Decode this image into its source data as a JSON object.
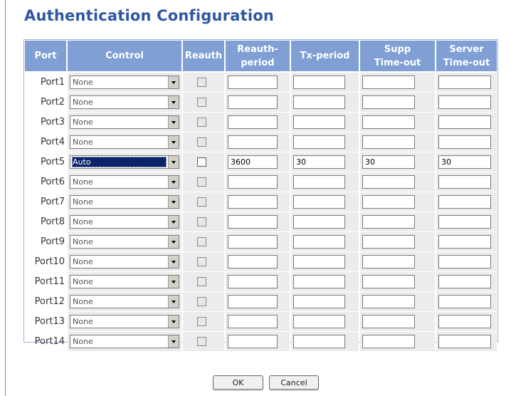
{
  "title": "Authentication Configuration",
  "headers": {
    "port": "Port",
    "control": "Control",
    "reauth": "Reauth",
    "reauth_period": "Reauth-\nperiod",
    "tx_period": "Tx-period",
    "supp_timeout": "Supp\nTime-out",
    "server_timeout": "Server\nTime-out"
  },
  "rows": [
    {
      "port": "Port1",
      "control": "None",
      "reauth": false,
      "reauth_period": "",
      "tx_period": "",
      "supp_timeout": "",
      "server_timeout": ""
    },
    {
      "port": "Port2",
      "control": "None",
      "reauth": false,
      "reauth_period": "",
      "tx_period": "",
      "supp_timeout": "",
      "server_timeout": ""
    },
    {
      "port": "Port3",
      "control": "None",
      "reauth": false,
      "reauth_period": "",
      "tx_period": "",
      "supp_timeout": "",
      "server_timeout": ""
    },
    {
      "port": "Port4",
      "control": "None",
      "reauth": false,
      "reauth_period": "",
      "tx_period": "",
      "supp_timeout": "",
      "server_timeout": ""
    },
    {
      "port": "Port5",
      "control": "Auto",
      "reauth": false,
      "enabled": true,
      "selected": true,
      "reauth_period": "3600",
      "tx_period": "30",
      "supp_timeout": "30",
      "server_timeout": "30"
    },
    {
      "port": "Port6",
      "control": "None",
      "reauth": false,
      "reauth_period": "",
      "tx_period": "",
      "supp_timeout": "",
      "server_timeout": ""
    },
    {
      "port": "Port7",
      "control": "None",
      "reauth": false,
      "reauth_period": "",
      "tx_period": "",
      "supp_timeout": "",
      "server_timeout": ""
    },
    {
      "port": "Port8",
      "control": "None",
      "reauth": false,
      "reauth_period": "",
      "tx_period": "",
      "supp_timeout": "",
      "server_timeout": ""
    },
    {
      "port": "Port9",
      "control": "None",
      "reauth": false,
      "reauth_period": "",
      "tx_period": "",
      "supp_timeout": "",
      "server_timeout": ""
    },
    {
      "port": "Port10",
      "control": "None",
      "reauth": false,
      "reauth_period": "",
      "tx_period": "",
      "supp_timeout": "",
      "server_timeout": ""
    },
    {
      "port": "Port11",
      "control": "None",
      "reauth": false,
      "reauth_period": "",
      "tx_period": "",
      "supp_timeout": "",
      "server_timeout": ""
    },
    {
      "port": "Port12",
      "control": "None",
      "reauth": false,
      "reauth_period": "",
      "tx_period": "",
      "supp_timeout": "",
      "server_timeout": ""
    },
    {
      "port": "Port13",
      "control": "None",
      "reauth": false,
      "reauth_period": "",
      "tx_period": "",
      "supp_timeout": "",
      "server_timeout": ""
    },
    {
      "port": "Port14",
      "control": "None",
      "reauth": false,
      "reauth_period": "",
      "tx_period": "",
      "supp_timeout": "",
      "server_timeout": ""
    }
  ],
  "buttons": {
    "ok": "OK",
    "cancel": "Cancel"
  },
  "colors": {
    "title": "#2f57a3",
    "header_bg": "#7f9fd5",
    "cell_bg": "#ececec",
    "selected_bg": "#0a246a"
  }
}
